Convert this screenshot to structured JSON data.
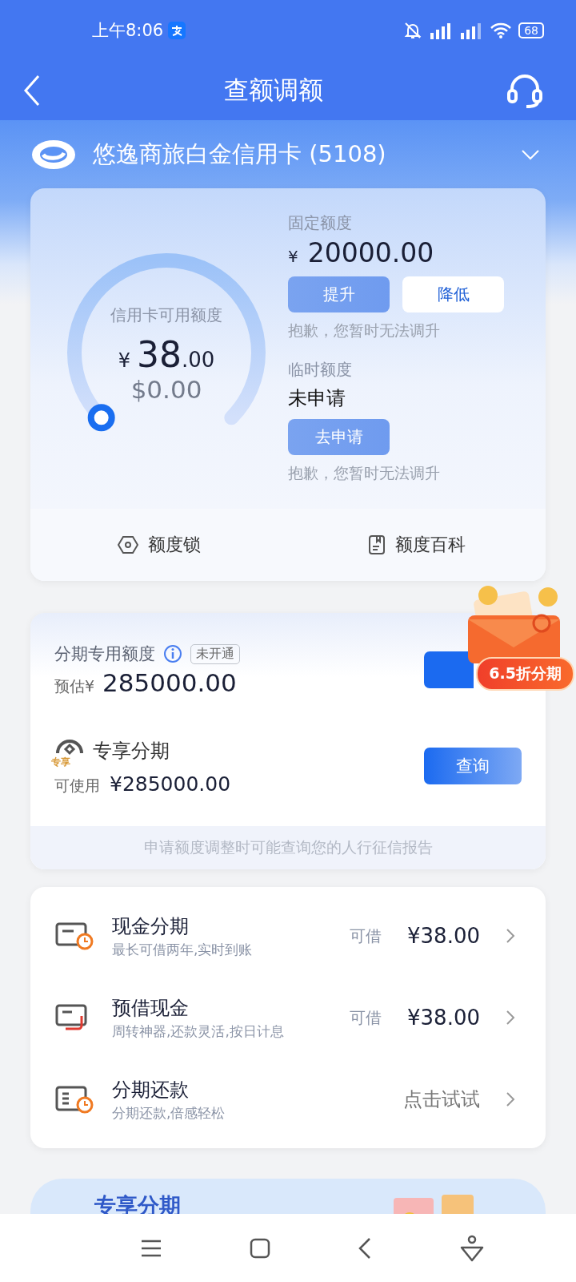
{
  "status_bar": {
    "time": "上午8:06",
    "battery": "68"
  },
  "header": {
    "title": "查额调额"
  },
  "card_selector": {
    "name": "悠逸商旅白金信用卡 (5108)"
  },
  "credit": {
    "gauge": {
      "label": "信用卡可用额度",
      "currency": "¥",
      "integer": "38",
      "decimals": ".00",
      "usd": "$0.00"
    },
    "fixed": {
      "label": "固定额度",
      "currency": "¥",
      "amount": "20000.00",
      "buttons": [
        {
          "label": "提升",
          "disabled": true
        },
        {
          "label": "降低",
          "disabled": false
        }
      ],
      "note": "抱歉，您暂时无法调升"
    },
    "temporary": {
      "label": "临时额度",
      "status": "未申请",
      "button": {
        "label": "去申请",
        "disabled": true
      },
      "note": "抱歉，您暂时无法调升"
    },
    "links": [
      {
        "label": "额度锁",
        "kind": "lock"
      },
      {
        "label": "额度百科",
        "kind": "book"
      }
    ]
  },
  "installment": {
    "dedicated": {
      "label": "分期专用额度",
      "tag": "未开通",
      "prefix": "预估¥",
      "amount": "285000.00"
    },
    "badge": "6.5折分期",
    "exclusive": {
      "icon_text": "专享",
      "title": "专享分期",
      "prefix": "可使用",
      "amount": "¥285000.00",
      "button": "查询"
    },
    "note": "申请额度调整时可能查询您的人行征信报告"
  },
  "services": [
    {
      "kind": "cash",
      "title": "现金分期",
      "subtitle": "最长可借两年,实时到账",
      "prefix": "可借",
      "value": "¥38.00"
    },
    {
      "kind": "advance",
      "title": "预借现金",
      "subtitle": "周转神器,还款灵活,按日计息",
      "prefix": "可借",
      "value": "¥38.00"
    },
    {
      "kind": "repay",
      "title": "分期还款",
      "subtitle": "分期还款,倍感轻松",
      "value": "点击试试"
    }
  ],
  "banner": {
    "title": "专享分期"
  }
}
